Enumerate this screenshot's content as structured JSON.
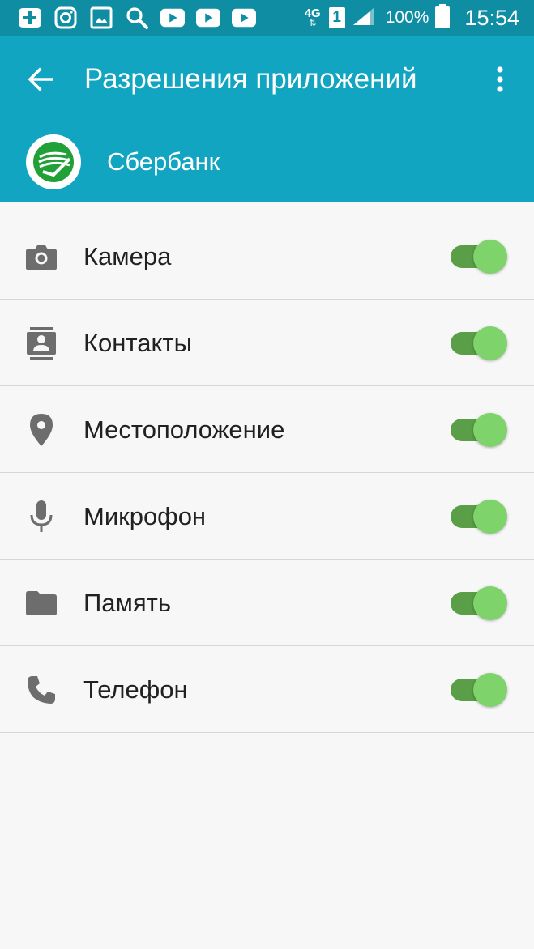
{
  "status_bar": {
    "network": "4G",
    "sim": "1",
    "battery": "100%",
    "time": "15:54",
    "notification_icons": [
      "add-icon",
      "instagram-icon",
      "gallery-icon",
      "search-icon",
      "youtube-icon",
      "youtube-icon",
      "youtube-icon"
    ]
  },
  "toolbar": {
    "title": "Разрешения приложений",
    "app_name": "Сбербанк"
  },
  "permissions": [
    {
      "label": "Камера",
      "icon": "camera-icon",
      "enabled": true
    },
    {
      "label": "Контакты",
      "icon": "contacts-icon",
      "enabled": true
    },
    {
      "label": "Местоположение",
      "icon": "location-icon",
      "enabled": true
    },
    {
      "label": "Микрофон",
      "icon": "microphone-icon",
      "enabled": true
    },
    {
      "label": "Память",
      "icon": "folder-icon",
      "enabled": true
    },
    {
      "label": "Телефон",
      "icon": "phone-icon",
      "enabled": true
    }
  ],
  "colors": {
    "status_bar": "#0f8ea3",
    "toolbar": "#11a5c1",
    "toggle_track": "#5a9e47",
    "toggle_thumb": "#7ed36a",
    "icon_gray": "#6d6d6d"
  }
}
